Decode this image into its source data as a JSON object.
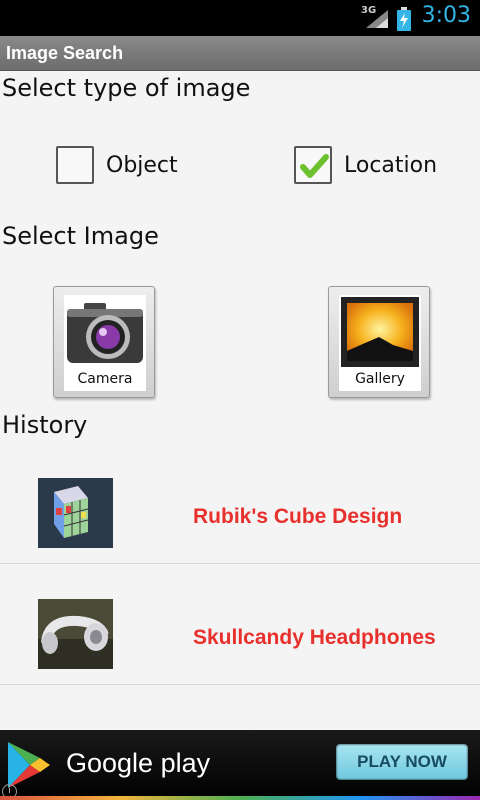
{
  "status_bar": {
    "network": "3G",
    "time": "3:03"
  },
  "app": {
    "title": "Image Search"
  },
  "type_section": {
    "heading": "Select type of image",
    "options": [
      {
        "label": "Object",
        "checked": false
      },
      {
        "label": "Location",
        "checked": true
      }
    ]
  },
  "image_section": {
    "heading": "Select Image",
    "buttons": [
      {
        "label": "Camera",
        "icon": "camera-icon"
      },
      {
        "label": "Gallery",
        "icon": "gallery-icon"
      }
    ]
  },
  "history": {
    "heading": "History",
    "items": [
      {
        "title": "Rubik's Cube Design",
        "thumb": "rubiks-cube-thumbnail"
      },
      {
        "title": "Skullcandy Headphones",
        "thumb": "headphones-thumbnail"
      }
    ]
  },
  "ad": {
    "brand": "Google play",
    "cta": "PLAY NOW",
    "info": "i"
  },
  "colors": {
    "accent": "#33b5e5",
    "history_title": "#e8302c",
    "check": "#6cc12f"
  }
}
